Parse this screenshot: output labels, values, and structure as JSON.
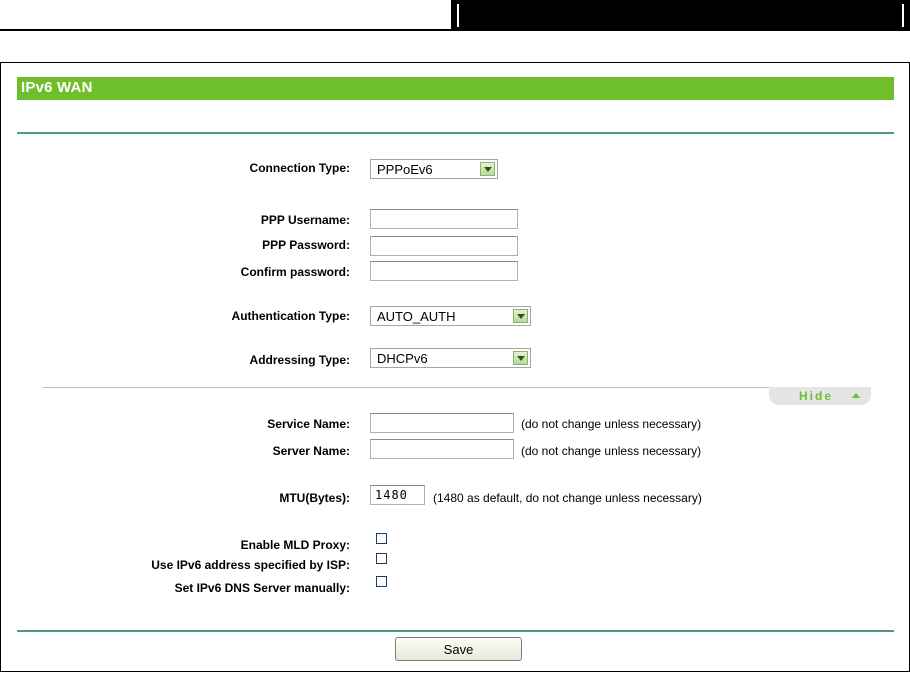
{
  "panel": {
    "title": "IPv6 WAN"
  },
  "fields": {
    "connection_type": {
      "label": "Connection Type:",
      "value": "PPPoEv6"
    },
    "ppp_username": {
      "label": "PPP Username:",
      "value": ""
    },
    "ppp_password": {
      "label": "PPP Password:",
      "value": ""
    },
    "confirm_password": {
      "label": "Confirm password:",
      "value": ""
    },
    "authentication_type": {
      "label": "Authentication Type:",
      "value": "AUTO_AUTH"
    },
    "addressing_type": {
      "label": "Addressing Type:",
      "value": "DHCPv6"
    }
  },
  "advanced": {
    "toggle_label": "Hide",
    "service_name": {
      "label": "Service Name:",
      "value": "",
      "hint": "(do not change unless necessary)"
    },
    "server_name": {
      "label": "Server Name:",
      "value": "",
      "hint": "(do not change unless necessary)"
    },
    "mtu": {
      "label": "MTU(Bytes):",
      "value": "1480",
      "hint": "(1480 as default, do not change unless necessary)"
    },
    "enable_mld_proxy": {
      "label": "Enable MLD Proxy:",
      "checked": false
    },
    "use_isp_ipv6": {
      "label": "Use IPv6 address specified by ISP:",
      "checked": false
    },
    "set_dns_manually": {
      "label": "Set IPv6 DNS Server manually:",
      "checked": false
    }
  },
  "actions": {
    "save_label": "Save"
  },
  "colors": {
    "accent": "#6fbf2c",
    "rule": "#4f9b7a"
  }
}
